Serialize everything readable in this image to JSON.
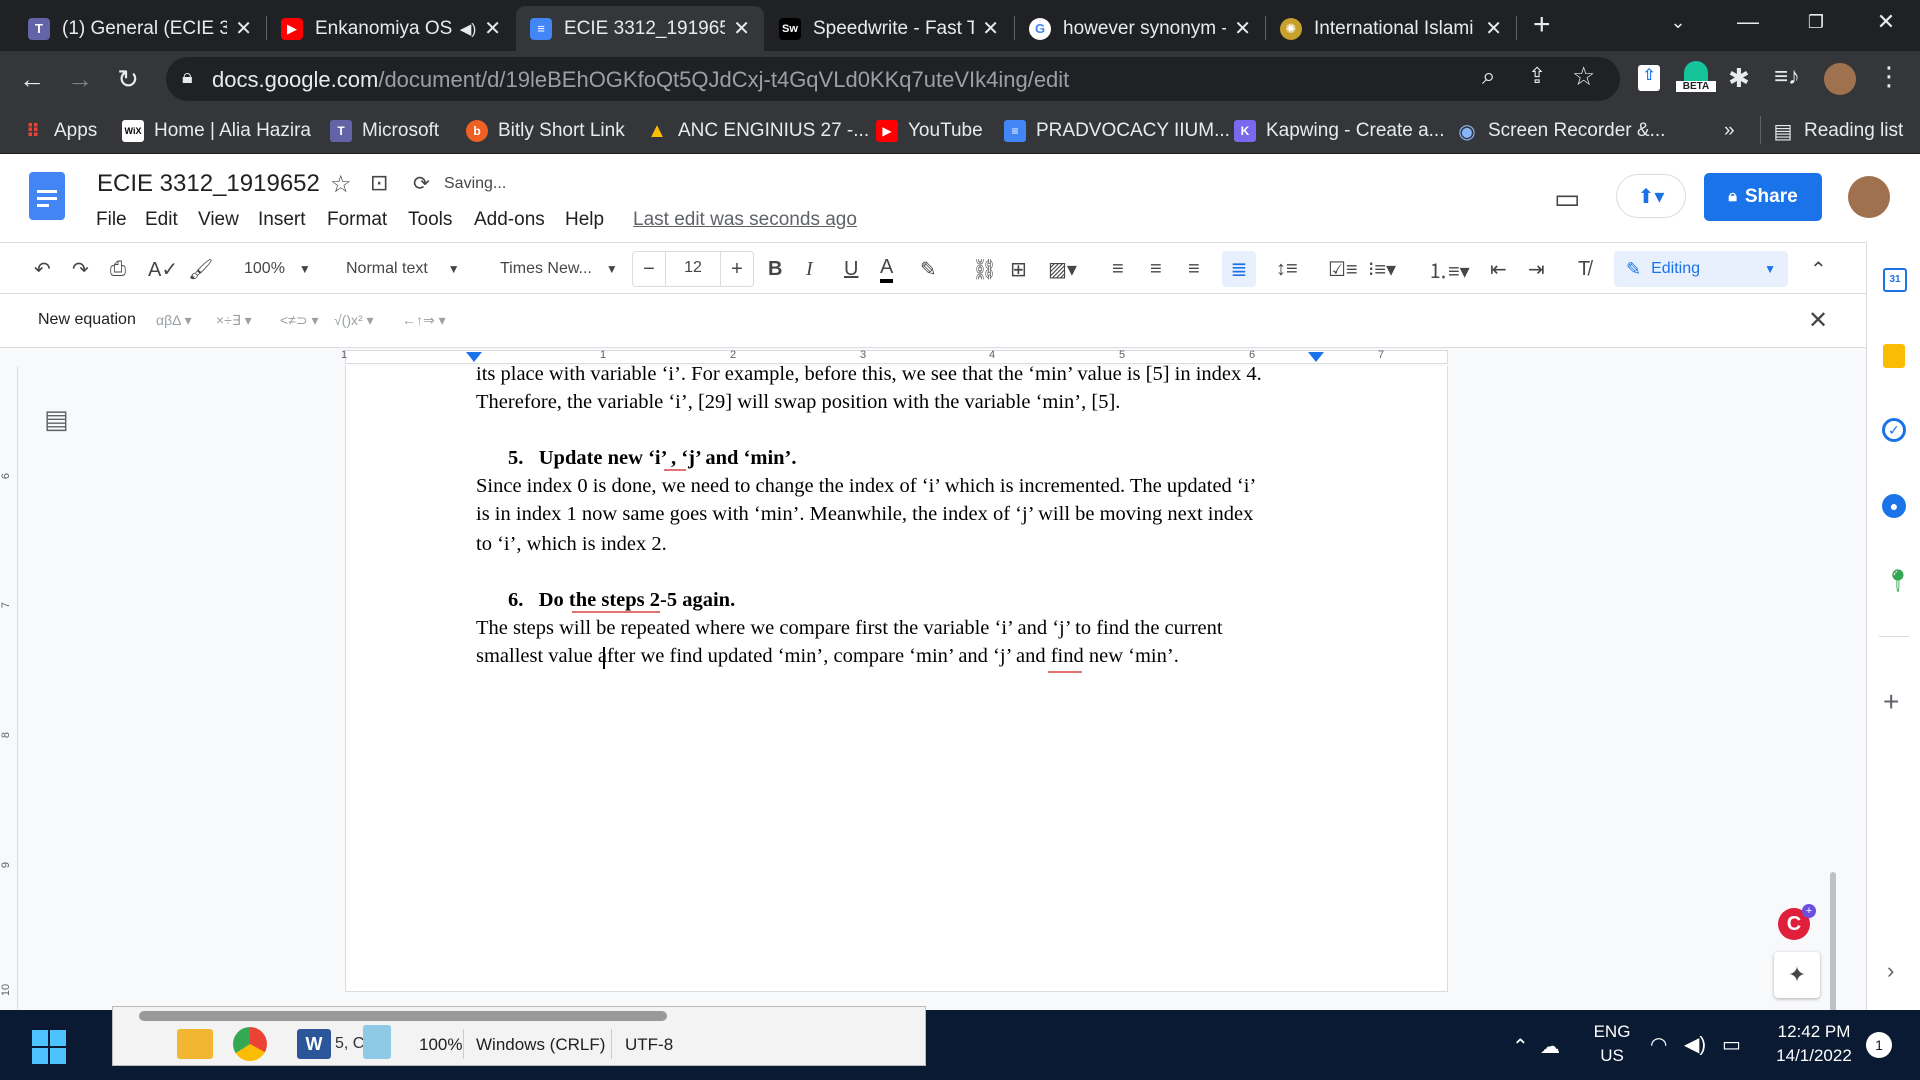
{
  "tabs": [
    {
      "title": "(1) General (ECIE 33",
      "icon": "teams-icon",
      "color": "#6264a7"
    },
    {
      "title": "Enkanomiya OS",
      "icon": "youtube-icon",
      "color": "#ff0000"
    },
    {
      "title": "ECIE 3312_1919652",
      "icon": "docs-icon",
      "color": "#4285f4",
      "active": true
    },
    {
      "title": "Speedwrite - Fast Te",
      "icon": "speedwrite-icon",
      "color": "#000000"
    },
    {
      "title": "however synonym -",
      "icon": "google-icon",
      "color": "#4285f4"
    },
    {
      "title": "International Islami",
      "icon": "iium-icon",
      "color": "#c8a02c"
    }
  ],
  "new_tab": "+",
  "address": {
    "host": "docs.google.com",
    "path": "/document/d/19leBEhOGKfoQt5QJdCxj-t4GqVLd0KKq7uteVIk4ing/edit"
  },
  "beta_badge": "BETA",
  "bookmarks": [
    {
      "label": "Apps",
      "icon": "apps-grid-icon",
      "color": "#ea4335"
    },
    {
      "label": "Home | Alia Hazira",
      "icon": "wix-icon",
      "color": "#000000"
    },
    {
      "label": "Microsoft",
      "icon": "teams-icon",
      "color": "#6264a7"
    },
    {
      "label": "Bitly Short Link",
      "icon": "bitly-icon",
      "color": "#ee6123"
    },
    {
      "label": "ANC ENGINIUS 27 -...",
      "icon": "drive-icon",
      "color": "#fbbc04"
    },
    {
      "label": "YouTube",
      "icon": "youtube-icon",
      "color": "#ff0000"
    },
    {
      "label": "PRADVOCACY IIUM...",
      "icon": "docs-icon",
      "color": "#4285f4"
    },
    {
      "label": "Kapwing - Create a...",
      "icon": "kapwing-icon",
      "color": "#7b68ee"
    },
    {
      "label": "Screen Recorder &...",
      "icon": "record-icon",
      "color": "#4285f4"
    }
  ],
  "more_bookmarks": "»",
  "reading_list": "Reading list",
  "doc": {
    "title": "ECIE 3312_1919652",
    "save_status": "Saving...",
    "menus": [
      "File",
      "Edit",
      "View",
      "Insert",
      "Format",
      "Tools",
      "Add-ons",
      "Help"
    ],
    "last_edit": "Last edit was seconds ago",
    "share_label": "Share"
  },
  "toolbar": {
    "zoom": "100%",
    "style": "Normal text",
    "font": "Times New...",
    "font_size": "12",
    "mode": "Editing"
  },
  "equation_bar": {
    "label": "New equation",
    "groups": [
      "αβΔ",
      "×÷∃",
      "<≠⊃",
      "√()x²",
      "←↑⇒"
    ]
  },
  "ruler_numbers": [
    "1",
    "1",
    "2",
    "3",
    "4",
    "5",
    "6",
    "7"
  ],
  "vruler_numbers": [
    "6",
    "7",
    "8",
    "9",
    "10"
  ],
  "content": {
    "line1": "its place with variable ‘i’. For example, before this, we see that the ‘min’ value is [5] in index 4.",
    "line2": "Therefore, the variable ‘i’, [29] will swap position with the variable ‘min’, [5].",
    "heading5_num": "5.",
    "heading5": "Update new ‘i’ , ‘j’ and ‘min’.",
    "p5_1": "Since index 0 is done, we need to change the index of ‘i’ which is incremented. The updated ‘i’",
    "p5_2": "is in index 1 now same goes with ‘min’. Meanwhile, the index of ‘j’ will be moving next index",
    "p5_3": "to ‘i’, which is index 2.",
    "heading6_num": "6.",
    "heading6": "Do the steps 2-5 again.",
    "p6_1": "The steps will be repeated where we compare first the variable ‘i’ and ‘j’ to find the current",
    "p6_2": "smallest value after we find updated ‘min’, compare ‘min’ and ‘j’ and find new ‘min’."
  },
  "word_status": {
    "zoom": "100%",
    "line_ending": "Windows (CRLF)",
    "encoding": "UTF-8",
    "partial_text": "5, Co"
  },
  "taskbar": {
    "lang_top": "ENG",
    "lang_bottom": "US",
    "time": "12:42 PM",
    "date": "14/1/2022",
    "notif_count": "1"
  }
}
